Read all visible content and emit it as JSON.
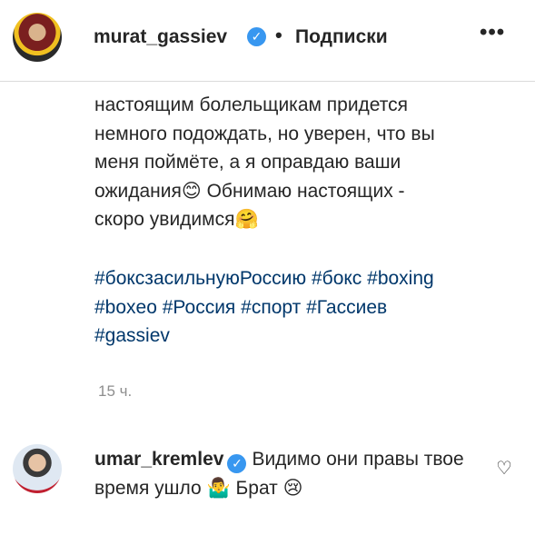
{
  "header": {
    "username": "murat_gassiev",
    "verified_glyph": "✓",
    "separator": "•",
    "follow_label": "Подписки",
    "more_glyph": "•••"
  },
  "caption": {
    "lines": [
      "настоящим болельщикам придется",
      "немного подождать, но уверен, что вы",
      "меня поймёте, а я оправдаю ваши",
      "ожидания😊 Обнимаю настоящих -",
      "скоро увидимся🤗"
    ]
  },
  "hashtags": [
    "#боксзасильнуюРоссию",
    "#бокс",
    "#boxing",
    "#boxeo",
    "#Россия",
    "#спорт",
    "#Гассиев",
    "#gassiev"
  ],
  "timestamp": "15 ч.",
  "comment": {
    "username": "umar_kremlev",
    "verified_glyph": "✓",
    "text": "Видимо они правы твое время ушло 🤷‍♂️ Брат 😢",
    "like_icon": "heart-outline-icon",
    "like_glyph": "♡"
  },
  "colors": {
    "verified": "#3897f0",
    "hashtag": "#00376b",
    "muted": "#8e8e8e"
  }
}
